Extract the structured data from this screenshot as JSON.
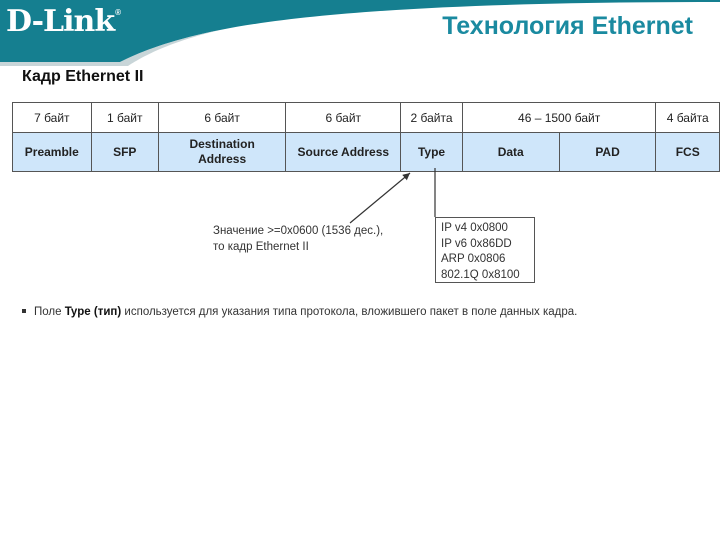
{
  "header": {
    "logo_text": "D-Link",
    "logo_mark": "®",
    "title": "Технология Ethernet",
    "brand_color": "#157f90",
    "title_color": "#1a8aa0"
  },
  "section_title": "Кадр Ethernet II",
  "frame_table": {
    "sizes": [
      "7 байт",
      "1 байт",
      "6 байт",
      "6 байт",
      "2 байта",
      "46 – 1500 байт",
      "4 байта"
    ],
    "fields": [
      "Preamble",
      "SFP",
      "Destination Address",
      "Source Address",
      "Type",
      "Data",
      "PAD",
      "FCS"
    ],
    "field_bg_color": "#cfe6fa"
  },
  "annotation": {
    "line1": "Значение >=0x0600 (1536 дес.),",
    "line2": "то кадр Ethernet II"
  },
  "type_values": [
    "IP v4 0x0800",
    "IP v6 0x86DD",
    "ARP 0x0806",
    "802.1Q 0x8100"
  ],
  "bullet": {
    "prefix": "Поле",
    "bold": "Type (тип)",
    "suffix": "используется для указания типа протокола, вложившего пакет в поле данных кадра."
  }
}
